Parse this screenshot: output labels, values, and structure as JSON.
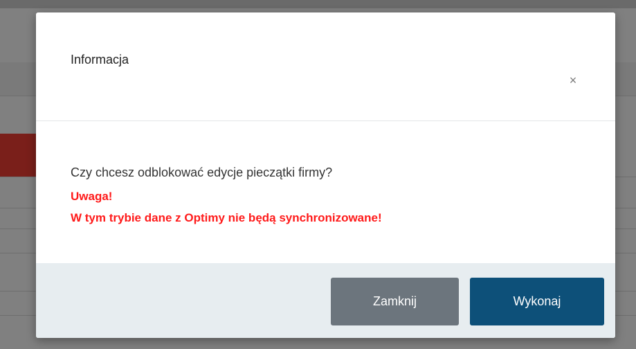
{
  "dialog": {
    "title": "Informacja",
    "close_icon": "×",
    "question": "Czy chcesz odblokować edycje pieczątki firmy?",
    "warning_title": "Uwaga!",
    "warning_text": "W tym trybie dane z Optimy nie będą synchronizowane!",
    "buttons": {
      "close_label": "Zamknij",
      "execute_label": "Wykonaj"
    }
  },
  "colors": {
    "warning": "#ff1a1a",
    "primary_button": "#0d5079",
    "secondary_button": "#6c757d",
    "footer_background": "#e7edf0",
    "backdrop": "#808080"
  }
}
